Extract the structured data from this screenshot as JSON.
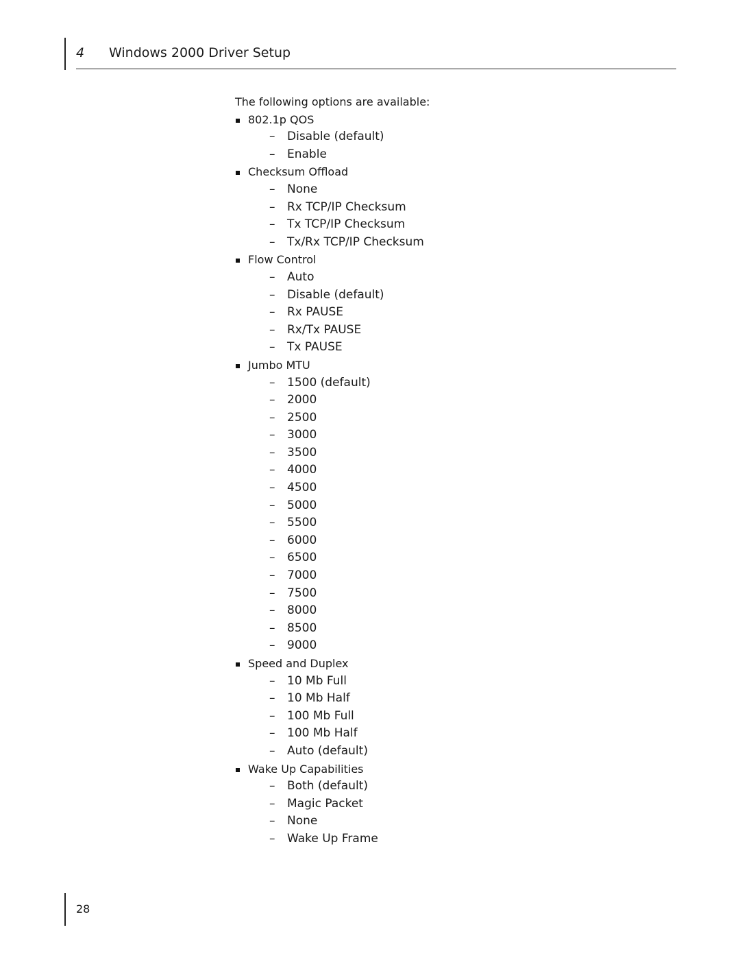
{
  "header": {
    "chapter_number": "4",
    "chapter_title": "Windows 2000 Driver Setup"
  },
  "intro": "The following options are available:",
  "options": [
    {
      "label": "802.1p QOS",
      "values": [
        "Disable (default)",
        "Enable"
      ]
    },
    {
      "label": "Checksum Offload",
      "values": [
        "None",
        "Rx TCP/IP Checksum",
        "Tx TCP/IP Checksum",
        "Tx/Rx TCP/IP Checksum"
      ]
    },
    {
      "label": "Flow Control",
      "values": [
        "Auto",
        "Disable (default)",
        "Rx PAUSE",
        "Rx/Tx PAUSE",
        "Tx PAUSE"
      ]
    },
    {
      "label": "Jumbo MTU",
      "values": [
        "1500 (default)",
        "2000",
        "2500",
        "3000",
        "3500",
        "4000",
        "4500",
        "5000",
        "5500",
        "6000",
        "6500",
        "7000",
        "7500",
        "8000",
        "8500",
        "9000"
      ]
    },
    {
      "label": "Speed and Duplex",
      "values": [
        "10 Mb Full",
        "10 Mb Half",
        "100 Mb Full",
        "100 Mb Half",
        "Auto (default)"
      ]
    },
    {
      "label": "Wake Up Capabilities",
      "values": [
        "Both (default)",
        "Magic Packet",
        "None",
        "Wake Up Frame"
      ]
    }
  ],
  "bullet_glyph": "square-bullet",
  "sub_glyph": "–",
  "footer": {
    "page_number": "28"
  }
}
